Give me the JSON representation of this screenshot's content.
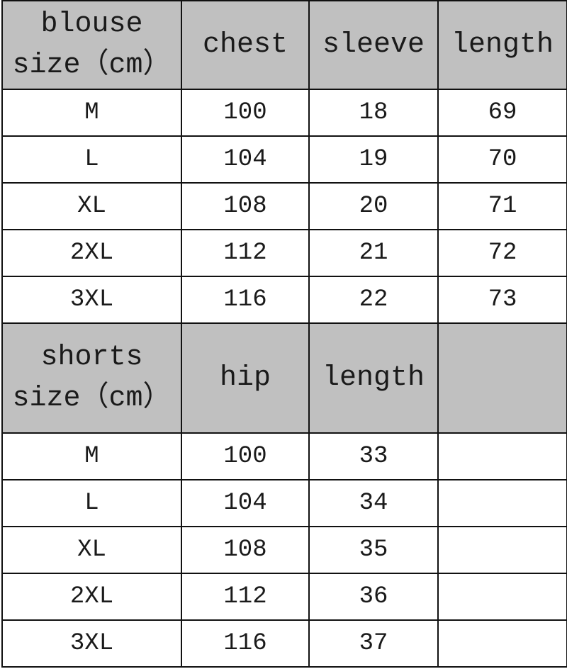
{
  "blouse": {
    "headers": [
      "blouse\nsize（cm）",
      "chest",
      "sleeve",
      "length"
    ],
    "header_lines": [
      "blouse",
      "size（cm）"
    ],
    "rows": [
      [
        "M",
        "100",
        "18",
        "69"
      ],
      [
        "L",
        "104",
        "19",
        "70"
      ],
      [
        "XL",
        "108",
        "20",
        "71"
      ],
      [
        "2XL",
        "112",
        "21",
        "72"
      ],
      [
        "3XL",
        "116",
        "22",
        "73"
      ]
    ]
  },
  "shorts": {
    "header_lines": [
      "shorts",
      "size（cm）"
    ],
    "headers": [
      "shorts\nsize（cm）",
      "hip",
      "length",
      ""
    ],
    "rows": [
      [
        "M",
        "100",
        "33",
        ""
      ],
      [
        "L",
        "104",
        "34",
        ""
      ],
      [
        "XL",
        "108",
        "35",
        ""
      ],
      [
        "2XL",
        "112",
        "36",
        ""
      ],
      [
        "3XL",
        "116",
        "37",
        ""
      ]
    ]
  },
  "colors": {
    "header_bg": "#c0c0c0",
    "border": "#111111"
  }
}
